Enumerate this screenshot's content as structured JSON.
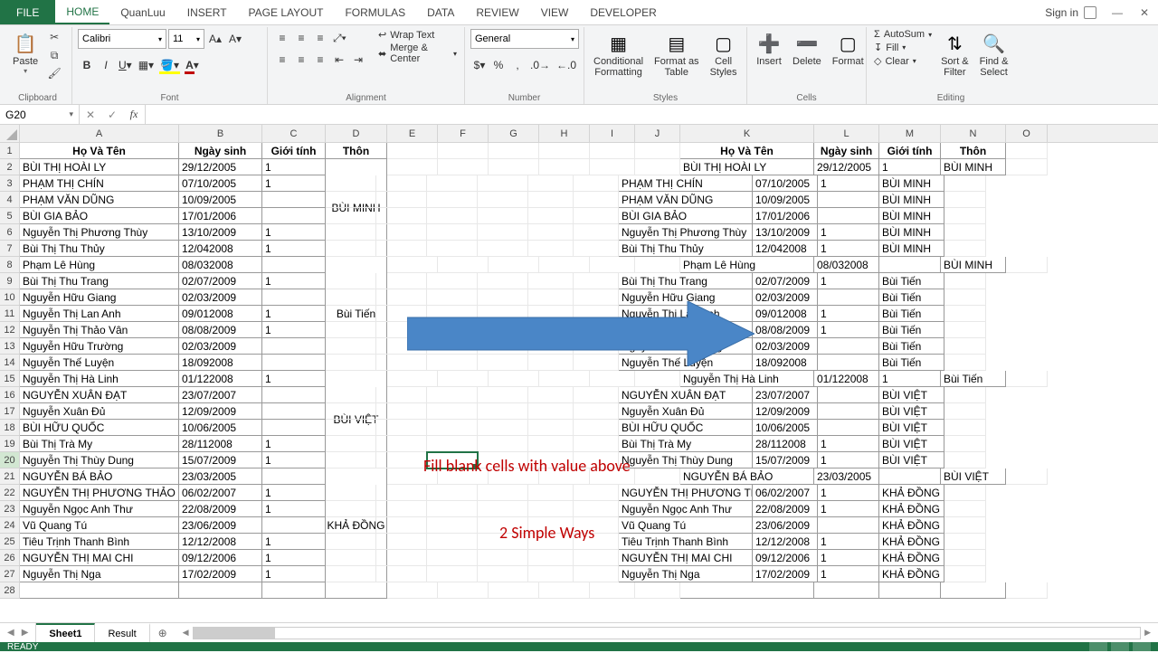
{
  "titlebar": {
    "file": "FILE",
    "tabs": [
      "HOME",
      "QuanLuu",
      "INSERT",
      "PAGE LAYOUT",
      "FORMULAS",
      "DATA",
      "REVIEW",
      "VIEW",
      "DEVELOPER"
    ],
    "active_tab": 0,
    "signin": "Sign in"
  },
  "ribbon": {
    "clipboard": {
      "paste": "Paste",
      "label": "Clipboard"
    },
    "font": {
      "name": "Calibri",
      "size": "11",
      "label": "Font"
    },
    "alignment": {
      "wrap": "Wrap Text",
      "merge": "Merge & Center",
      "label": "Alignment"
    },
    "number": {
      "format": "General",
      "label": "Number"
    },
    "styles": {
      "cond": "Conditional\nFormatting",
      "table": "Format as\nTable",
      "cell": "Cell\nStyles",
      "label": "Styles"
    },
    "cells": {
      "insert": "Insert",
      "delete": "Delete",
      "format": "Format",
      "label": "Cells"
    },
    "editing": {
      "autosum": "AutoSum",
      "fill": "Fill",
      "clear": "Clear",
      "sort": "Sort &\nFilter",
      "find": "Find &\nSelect",
      "label": "Editing"
    }
  },
  "namebox": "G20",
  "columns": {
    "left": [
      "A",
      "B",
      "C",
      "D"
    ],
    "mid": [
      "E",
      "F",
      "G",
      "H",
      "I",
      "J"
    ],
    "right": [
      "K",
      "L",
      "M",
      "N",
      "O"
    ]
  },
  "col_widths": {
    "A": 176,
    "B": 92,
    "C": 70,
    "D": 68,
    "E": 56,
    "F": 56,
    "G": 56,
    "H": 56,
    "I": 50,
    "J": 50,
    "K": 148,
    "L": 72,
    "M": 68,
    "N": 72,
    "O": 46
  },
  "headers": {
    "name": "Họ Và Tên",
    "dob": "Ngày sinh",
    "sex": "Giới tính",
    "village": "Thôn"
  },
  "overlay": {
    "line1": "Fill blank cells with value above",
    "line2": "2 Simple Ways"
  },
  "left_data": [
    {
      "n": "BÙI THỊ HOÀI  LY",
      "d": "29/12/2005",
      "s": "1",
      "v": ""
    },
    {
      "n": "PHẠM THỊ  CHÍN",
      "d": "07/10/2005",
      "s": "1",
      "v": ""
    },
    {
      "n": "PHẠM VĂN DŨNG",
      "d": "10/09/2005",
      "s": "",
      "v": ""
    },
    {
      "n": "BÙI GIA BẢO",
      "d": "17/01/2006",
      "s": "",
      "v": "BÙI MINH"
    },
    {
      "n": "Nguyễn Thị Phương Thùy",
      "d": "13/10/2009",
      "s": "1",
      "v": ""
    },
    {
      "n": "Bùi Thị Thu Thủy",
      "d": "12/042008",
      "s": "1",
      "v": ""
    },
    {
      "n": "Phạm Lê Hùng",
      "d": "08/032008",
      "s": "",
      "v": ""
    },
    {
      "n": "Bùi Thị Thu Trang",
      "d": "02/07/2009",
      "s": "1",
      "v": ""
    },
    {
      "n": "Nguyễn Hữu Giang",
      "d": "02/03/2009",
      "s": "",
      "v": ""
    },
    {
      "n": "Nguyễn Thị Lan Anh",
      "d": "09/012008",
      "s": "1",
      "v": ""
    },
    {
      "n": "Nguyễn Thị Thảo Vân",
      "d": "08/08/2009",
      "s": "1",
      "v": "Bùi Tiến"
    },
    {
      "n": "Nguyễn Hữu Trường",
      "d": "02/03/2009",
      "s": "",
      "v": ""
    },
    {
      "n": "Nguyễn Thế Luyện",
      "d": "18/092008",
      "s": "",
      "v": ""
    },
    {
      "n": "Nguyễn Thị Hà Linh",
      "d": "01/122008",
      "s": "1",
      "v": ""
    },
    {
      "n": "NGUYỄN XUÂN  ĐẠT",
      "d": "23/07/2007",
      "s": "",
      "v": ""
    },
    {
      "n": "Nguyễn Xuân Đủ",
      "d": "12/09/2009",
      "s": "",
      "v": ""
    },
    {
      "n": "BÙI HỮU QUỐC",
      "d": "10/06/2005",
      "s": "",
      "v": "BÙI VIỆT"
    },
    {
      "n": "Bùi Thị Trà My",
      "d": "28/112008",
      "s": "1",
      "v": ""
    },
    {
      "n": "Nguyễn Thị Thùy Dung",
      "d": "15/07/2009",
      "s": "1",
      "v": ""
    },
    {
      "n": "NGUYỄN BÁ BẢO",
      "d": "23/03/2005",
      "s": "",
      "v": ""
    },
    {
      "n": "NGUYỄN THỊ PHƯƠNG  THẢO",
      "d": "06/02/2007",
      "s": "1",
      "v": ""
    },
    {
      "n": "Nguyễn Ngọc Anh Thư",
      "d": "22/08/2009",
      "s": "1",
      "v": ""
    },
    {
      "n": "Vũ Quang Tú",
      "d": "23/06/2009",
      "s": "",
      "v": "KHẢ ĐỒNG"
    },
    {
      "n": "Tiêu Trịnh Thanh Bình",
      "d": "12/12/2008",
      "s": "1",
      "v": ""
    },
    {
      "n": "NGUYỄN THỊ MAI CHI",
      "d": "09/12/2006",
      "s": "1",
      "v": ""
    },
    {
      "n": "Nguyễn Thị Nga",
      "d": "17/02/2009",
      "s": "1",
      "v": ""
    }
  ],
  "left_merge": {
    "2": {
      "span": 6,
      "label": "BÙI MINH"
    },
    "8": {
      "span": 7,
      "label": "Bùi Tiến"
    },
    "15": {
      "span": 6,
      "label": "BÙI VIỆT"
    },
    "21": {
      "span": 7,
      "label": "KHẢ ĐỒNG"
    }
  },
  "right_data": [
    {
      "n": "BÙI THỊ HOÀI  LY",
      "d": "29/12/2005",
      "s": "1",
      "v": "BÙI MINH"
    },
    {
      "n": "PHẠM THỊ  CHÍN",
      "d": "07/10/2005",
      "s": "1",
      "v": "BÙI MINH"
    },
    {
      "n": "PHẠM VĂN DŨNG",
      "d": "10/09/2005",
      "s": "",
      "v": "BÙI MINH"
    },
    {
      "n": "BÙI GIA BẢO",
      "d": "17/01/2006",
      "s": "",
      "v": "BÙI MINH"
    },
    {
      "n": "Nguyễn Thị Phương Thùy",
      "d": "13/10/2009",
      "s": "1",
      "v": "BÙI MINH"
    },
    {
      "n": "Bùi Thị Thu Thủy",
      "d": "12/042008",
      "s": "1",
      "v": "BÙI MINH"
    },
    {
      "n": "Phạm Lê Hùng",
      "d": "08/032008",
      "s": "",
      "v": "BÙI MINH"
    },
    {
      "n": "Bùi Thị Thu Trang",
      "d": "02/07/2009",
      "s": "1",
      "v": "Bùi Tiến"
    },
    {
      "n": "Nguyễn Hữu Giang",
      "d": "02/03/2009",
      "s": "",
      "v": "Bùi Tiến"
    },
    {
      "n": "Nguyễn Thị Lan Anh",
      "d": "09/012008",
      "s": "1",
      "v": "Bùi Tiến"
    },
    {
      "n": "Nguyễn Thị Thảo Vân",
      "d": "08/08/2009",
      "s": "1",
      "v": "Bùi Tiến"
    },
    {
      "n": "Nguyễn Hữu Trường",
      "d": "02/03/2009",
      "s": "",
      "v": "Bùi Tiến"
    },
    {
      "n": "Nguyễn Thế Luyện",
      "d": "18/092008",
      "s": "",
      "v": "Bùi Tiến"
    },
    {
      "n": "Nguyễn Thị Hà Linh",
      "d": "01/122008",
      "s": "1",
      "v": "Bùi Tiến"
    },
    {
      "n": "NGUYỄN XUÂN  ĐẠT",
      "d": "23/07/2007",
      "s": "",
      "v": "BÙI VIỆT"
    },
    {
      "n": "Nguyễn Xuân Đủ",
      "d": "12/09/2009",
      "s": "",
      "v": "BÙI VIỆT"
    },
    {
      "n": "BÙI HỮU QUỐC",
      "d": "10/06/2005",
      "s": "",
      "v": "BÙI VIỆT"
    },
    {
      "n": "Bùi Thị Trà My",
      "d": "28/112008",
      "s": "1",
      "v": "BÙI VIỆT"
    },
    {
      "n": "Nguyễn Thị Thùy Dung",
      "d": "15/07/2009",
      "s": "1",
      "v": "BÙI VIỆT"
    },
    {
      "n": "NGUYỄN BÁ BẢO",
      "d": "23/03/2005",
      "s": "",
      "v": "BÙI VIỆT"
    },
    {
      "n": "NGUYỄN THỊ PHƯƠNG  THẢO",
      "d": "06/02/2007",
      "s": "1",
      "v": "KHẢ ĐỒNG"
    },
    {
      "n": "Nguyễn Ngọc Anh Thư",
      "d": "22/08/2009",
      "s": "1",
      "v": "KHẢ ĐỒNG"
    },
    {
      "n": "Vũ Quang Tú",
      "d": "23/06/2009",
      "s": "",
      "v": "KHẢ ĐỒNG"
    },
    {
      "n": "Tiêu Trịnh Thanh Bình",
      "d": "12/12/2008",
      "s": "1",
      "v": "KHẢ ĐỒNG"
    },
    {
      "n": "NGUYỄN THỊ MAI CHI",
      "d": "09/12/2006",
      "s": "1",
      "v": "KHẢ ĐỒNG"
    },
    {
      "n": "Nguyễn Thị Nga",
      "d": "17/02/2009",
      "s": "1",
      "v": "KHẢ ĐỒNG"
    }
  ],
  "sheets": {
    "tabs": [
      "Sheet1",
      "Result"
    ],
    "active": 0
  },
  "status": "READY",
  "selected_cell_row": 20,
  "selected_cell_col": "G"
}
